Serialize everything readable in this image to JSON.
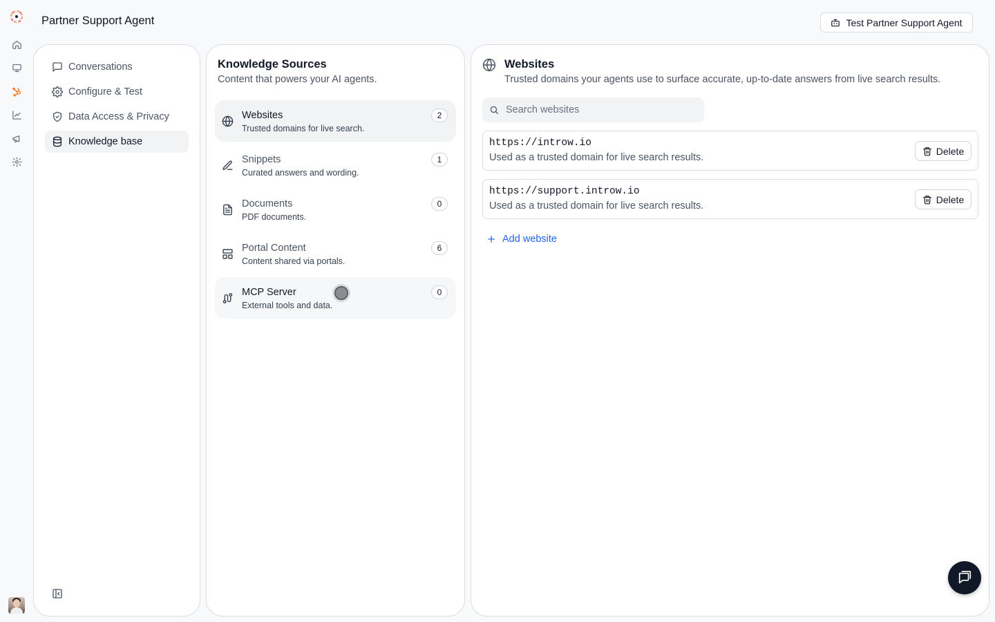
{
  "app": {
    "title": "Partner Support Agent",
    "test_button_label": "Test Partner Support Agent"
  },
  "rail": {
    "items": [
      "home-icon",
      "monitor-icon",
      "hubspot-icon",
      "chart-icon",
      "megaphone-icon",
      "gear-icon"
    ]
  },
  "nav": {
    "items": [
      {
        "label": "Conversations",
        "icon": "message-square-icon"
      },
      {
        "label": "Configure & Test",
        "icon": "gear-icon"
      },
      {
        "label": "Data Access & Privacy",
        "icon": "shield-icon"
      },
      {
        "label": "Knowledge base",
        "icon": "database-icon",
        "active": true
      }
    ]
  },
  "sources": {
    "title": "Knowledge Sources",
    "subtitle": "Content that powers your AI agents.",
    "items": [
      {
        "name": "Websites",
        "desc": "Trusted domains for live search.",
        "count": "2",
        "icon": "globe-icon"
      },
      {
        "name": "Snippets",
        "desc": "Curated answers and wording.",
        "count": "1",
        "icon": "pencil-icon"
      },
      {
        "name": "Documents",
        "desc": "PDF documents.",
        "count": "0",
        "icon": "file-text-icon"
      },
      {
        "name": "Portal Content",
        "desc": "Content shared via portals.",
        "count": "6",
        "icon": "layout-icon"
      },
      {
        "name": "MCP Server",
        "desc": "External tools and data.",
        "count": "0",
        "icon": "route-icon"
      }
    ]
  },
  "detail": {
    "title": "Websites",
    "subtitle": "Trusted domains your agents use to surface accurate, up-to-date answers from live search results.",
    "search_placeholder": "Search websites",
    "sites": [
      {
        "url": "https://introw.io",
        "desc": "Used as a trusted domain for live search results.",
        "delete_label": "Delete"
      },
      {
        "url": "https://support.introw.io",
        "desc": "Used as a trusted domain for live search results.",
        "delete_label": "Delete"
      }
    ],
    "add_label": "Add website"
  },
  "colors": {
    "accent": "#2563eb",
    "active_bg": "#f1f3f5",
    "fab_bg": "#111827"
  }
}
